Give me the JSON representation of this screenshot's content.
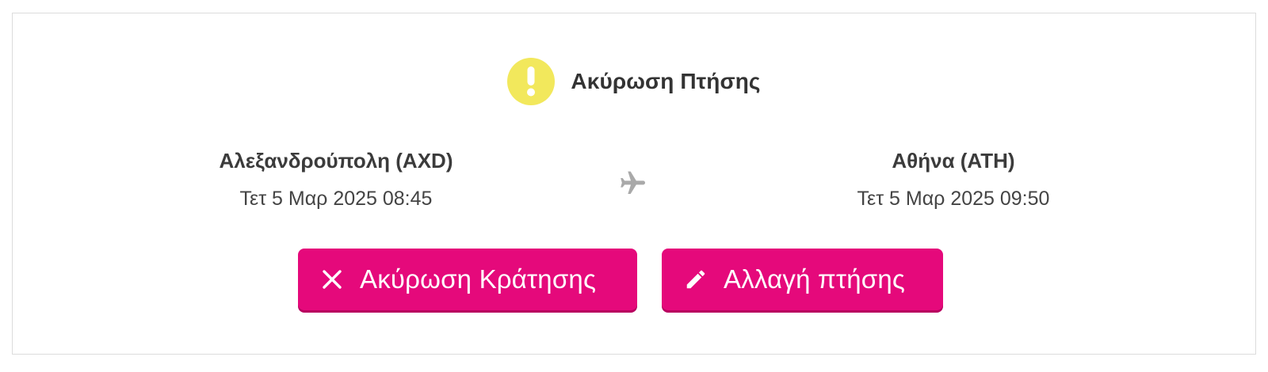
{
  "notice": {
    "icon": "warning-icon",
    "icon_color": "#f2e85c",
    "title": "Ακύρωση Πτήσης"
  },
  "flight": {
    "origin": {
      "city": "Αλεξανδρούπολη (AXD)",
      "datetime": "Τετ 5 Μαρ 2025 08:45"
    },
    "destination": {
      "city": "Αθήνα (ATH)",
      "datetime": "Τετ 5 Μαρ 2025 09:50"
    },
    "icon": "airplane-icon"
  },
  "actions": {
    "accent_color": "#e5097b",
    "cancel_booking": {
      "label": "Ακύρωση Κράτησης",
      "icon": "close-icon"
    },
    "change_flight": {
      "label": "Αλλαγή πτήσης",
      "icon": "pencil-icon"
    }
  }
}
